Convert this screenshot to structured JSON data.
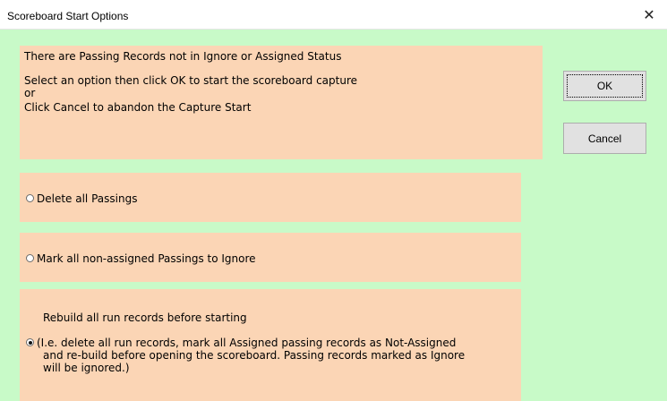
{
  "dialog": {
    "title": "Scoreboard Start Options",
    "close_glyph": "✕"
  },
  "message": {
    "lines": [
      "There are Passing Records not in Ignore or Assigned Status",
      "Select an option then click OK to start the scoreboard capture",
      "or",
      "Click Cancel to abandon the Capture Start"
    ]
  },
  "options": [
    {
      "label": "Delete all Passings",
      "selected": false
    },
    {
      "label": "Mark all non-assigned Passings to Ignore",
      "selected": false
    },
    {
      "heading": "Rebuild all run records before starting",
      "label_lines": [
        "(I.e. delete all run records, mark all Assigned passing records as Not-Assigned",
        "and re-build before opening the scoreboard. Passing records marked as Ignore",
        "will be ignored.)"
      ],
      "selected": true
    }
  ],
  "buttons": {
    "ok_label": "OK",
    "cancel_label": "Cancel"
  },
  "colors": {
    "dialog_background": "#c8fac8",
    "panel_background": "#fbd5b5"
  }
}
